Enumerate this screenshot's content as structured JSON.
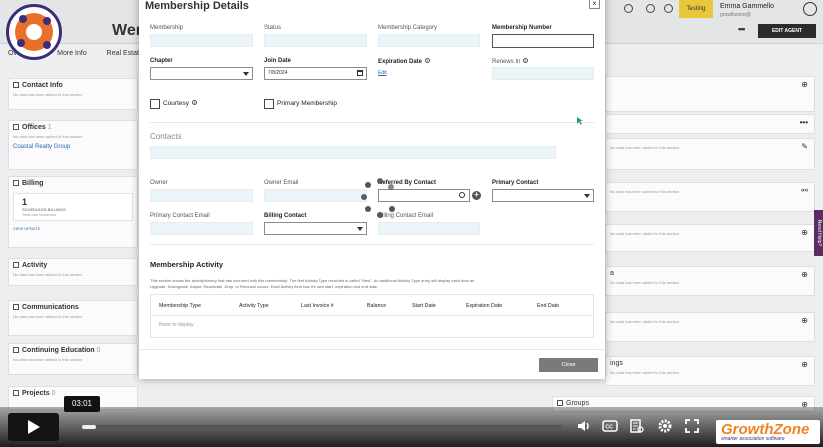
{
  "colors": {
    "brand_orange": "#e9702a",
    "brand_purple": "#3a2e7a",
    "input_bg": "#eaf4f9",
    "link": "#2a6ab5",
    "testing_badge": "#e8c73a"
  },
  "app": {
    "title_partial": "Weng",
    "tabs": [
      "Overview",
      "More Info",
      "Real Estate"
    ],
    "testing_badge": "Testing",
    "user_name": "Emma Gammello",
    "user_sub": "growthzone@",
    "edit_agent": "EDIT AGENT",
    "empty_text": "No data has been added to this section",
    "left_cards": {
      "contact_info": "Contact Info",
      "offices": "Offices",
      "offices_count": "1",
      "office_link": "Coastal Realty Group",
      "billing": "Billing",
      "billing_count": "1",
      "billing_sub": "SCHEDULED BILLINGS",
      "billing_sub2": "Total due tomorrow",
      "billing_link": "VIEW UPDATE",
      "activity": "Activity",
      "communications": "Communications",
      "continuing_education": "Continuing Education",
      "ce_count": "0",
      "projects": "Projects",
      "projects_count": "0"
    },
    "right_cards": {
      "rc1_title": "",
      "rc5_title": "a",
      "rc7_title": "ings",
      "groups": "Groups"
    },
    "need_help": "Need Help?"
  },
  "modal": {
    "title": "Membership Details",
    "close_glyph": "×",
    "fields": {
      "membership_label": "Membership",
      "membership_value": "",
      "status_label": "Status",
      "status_value": "",
      "category_label": "Membership Category",
      "category_value": "",
      "number_label": "Membership Number",
      "number_value": "",
      "chapter_label": "Chapter",
      "chapter_value": "",
      "join_label": "Join Date",
      "join_value": "7/8/2024",
      "expiration_label": "Expiration Date",
      "expiration_edit": "Edit",
      "renews_label": "Renews In",
      "renews_value": "",
      "courtesy_label": "Courtesy",
      "primary_membership_label": "Primary Membership"
    },
    "contacts": {
      "section_title": "Contacts",
      "owner_label": "Owner",
      "owner_email_label": "Owner Email",
      "referred_label": "Referred By Contact",
      "primary_contact_label": "Primary Contact",
      "primary_contact_email_label": "Primary Contact Email",
      "billing_contact_label": "Billing Contact",
      "billing_contact_email_label": "Billing Contact Email"
    },
    "activity": {
      "title": "Membership Activity",
      "description_line1": "This section shows the activity/history that has occurred with this membership. The first Activity Type recorded is called \"New\". An additional Activity Type entry will display each time an",
      "description_line2": "Upgrade, Downgrade, Adjust, Reactivate, Drop, or Renewal occurs. Each Activity item has it's own start, expiration and end date.",
      "columns": [
        "Membership Type",
        "Activity Type",
        "Last Invoice #",
        "Balance",
        "Start Date",
        "Expiration Date",
        "End Date"
      ],
      "empty": "None to display"
    },
    "close_button": "Close"
  },
  "player": {
    "time_tooltip": "03:01",
    "progress": 0.03,
    "controls": [
      "volume-icon",
      "captions-icon",
      "transcript-icon",
      "settings-icon",
      "fullscreen-icon",
      "share-icon"
    ],
    "brand_main": "GrowthZone",
    "brand_sub": "smarter association software"
  }
}
